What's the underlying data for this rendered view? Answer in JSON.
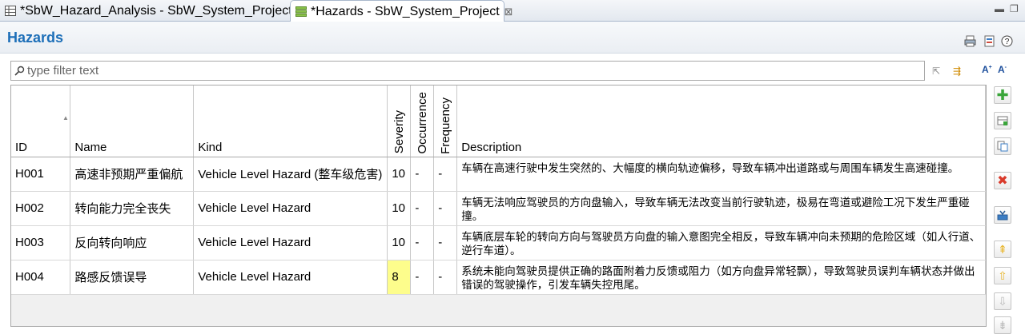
{
  "tabs": [
    {
      "label": "*SbW_Hazard_Analysis - SbW_System_Project",
      "active": false
    },
    {
      "label": "*Hazards - SbW_System_Project",
      "active": true
    }
  ],
  "header": {
    "title": "Hazards"
  },
  "filter": {
    "placeholder": "type filter text",
    "value": ""
  },
  "table": {
    "columns": [
      "ID",
      "Name",
      "Kind",
      "Severity",
      "Occurrence",
      "Frequency",
      "Description"
    ],
    "rows": [
      {
        "id": "H001",
        "name": "高速非预期严重偏航",
        "kind": "Vehicle Level Hazard (整车级危害)",
        "severity": "10",
        "occurrence": "-",
        "frequency": "-",
        "description": "车辆在高速行驶中发生突然的、大幅度的横向轨迹偏移，导致车辆冲出道路或与周围车辆发生高速碰撞。"
      },
      {
        "id": "H002",
        "name": "转向能力完全丧失",
        "kind": "Vehicle Level Hazard",
        "severity": "10",
        "occurrence": "-",
        "frequency": "-",
        "description": "车辆无法响应驾驶员的方向盘输入，导致车辆无法改变当前行驶轨迹，极易在弯道或避险工况下发生严重碰撞。"
      },
      {
        "id": "H003",
        "name": "反向转向响应",
        "kind": "Vehicle Level Hazard",
        "severity": "10",
        "occurrence": "-",
        "frequency": "-",
        "description": "车辆底层车轮的转向方向与驾驶员方向盘的输入意图完全相反，导致车辆冲向未预期的危险区域（如人行道、逆行车道）。"
      },
      {
        "id": "H004",
        "name": "路感反馈误导",
        "kind": "Vehicle Level Hazard",
        "severity": "8",
        "occurrence": "-",
        "frequency": "-",
        "description": "系统未能向驾驶员提供正确的路面附着力反馈或阻力（如方向盘异常轻飘），导致驾驶员误判车辆状态并做出错误的驾驶操作，引发车辆失控甩尾。"
      }
    ]
  },
  "colors": {
    "title": "#1d6fb8",
    "severity_highlight": "#fdfd8c",
    "add": "#3aa53a",
    "delete": "#d93a2b",
    "move": "#e8b52a"
  },
  "icons": [
    "table-icon",
    "list-icon",
    "close-icon",
    "minimize-icon",
    "maximize-icon",
    "print-icon",
    "export-icon",
    "help-icon",
    "search-icon",
    "collapse-icon",
    "filter-icon",
    "font-increase-icon",
    "font-decrease-icon",
    "add-icon",
    "add-row-icon",
    "copy-icon",
    "delete-icon",
    "import-icon",
    "move-top-icon",
    "move-up-icon",
    "move-down-icon"
  ]
}
